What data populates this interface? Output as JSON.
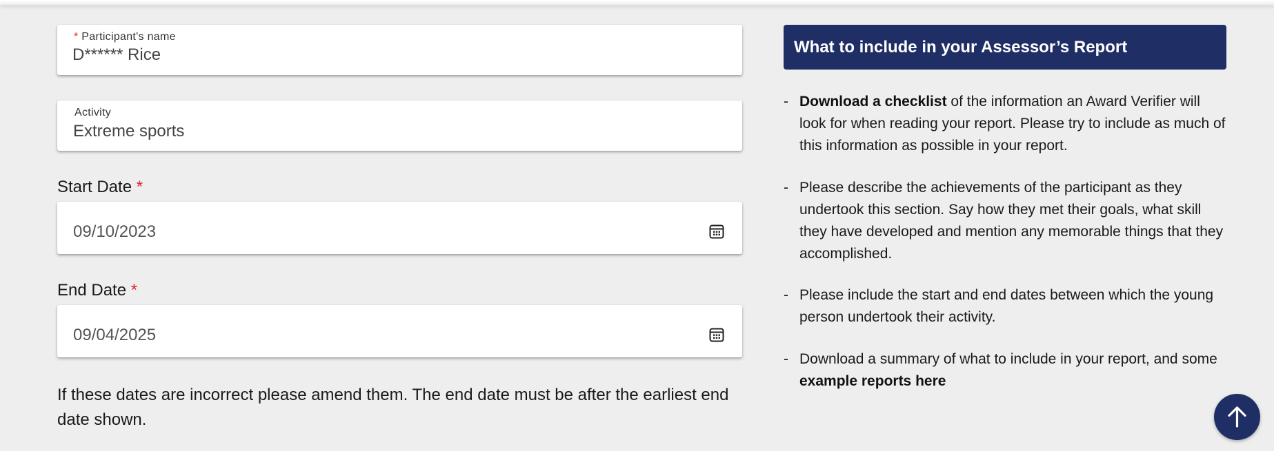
{
  "form": {
    "participant": {
      "label": "Participant's name",
      "required_mark": "*",
      "value": "D****** Rice"
    },
    "activity": {
      "label": "Activity",
      "value": "Extreme sports"
    },
    "start_date": {
      "label": "Start Date",
      "required_mark": "*",
      "value": "09/10/2023",
      "icon": "calendar-icon"
    },
    "end_date": {
      "label": "End Date",
      "required_mark": "*",
      "value": "09/04/2025",
      "icon": "calendar-icon"
    },
    "note": "If these dates are incorrect please amend them. The end date must be after the earliest end date shown."
  },
  "panel": {
    "title": "What to include in your Assessor’s Report",
    "title_bg": "#1f2f66",
    "bullets": [
      {
        "dash": "-",
        "link": "Download a checklist",
        "text": " of the information an Award Verifier will look for when reading your report. Please try to include as much of this information as possible in your report."
      },
      {
        "dash": "-",
        "text": "Please describe the achievements of the participant as they undertook this section. Say how they met their goals, what skill they have developed and mention any memorable things that they accomplished."
      },
      {
        "dash": "-",
        "text": "Please include the start and end dates between which the young person undertook their activity."
      },
      {
        "dash": "-",
        "text_before": "Download a summary of what to include in your report, and some ",
        "link": "example reports here"
      }
    ]
  },
  "scroll_top_button": {
    "icon": "arrow-up-icon",
    "color": "#1f2f66"
  }
}
